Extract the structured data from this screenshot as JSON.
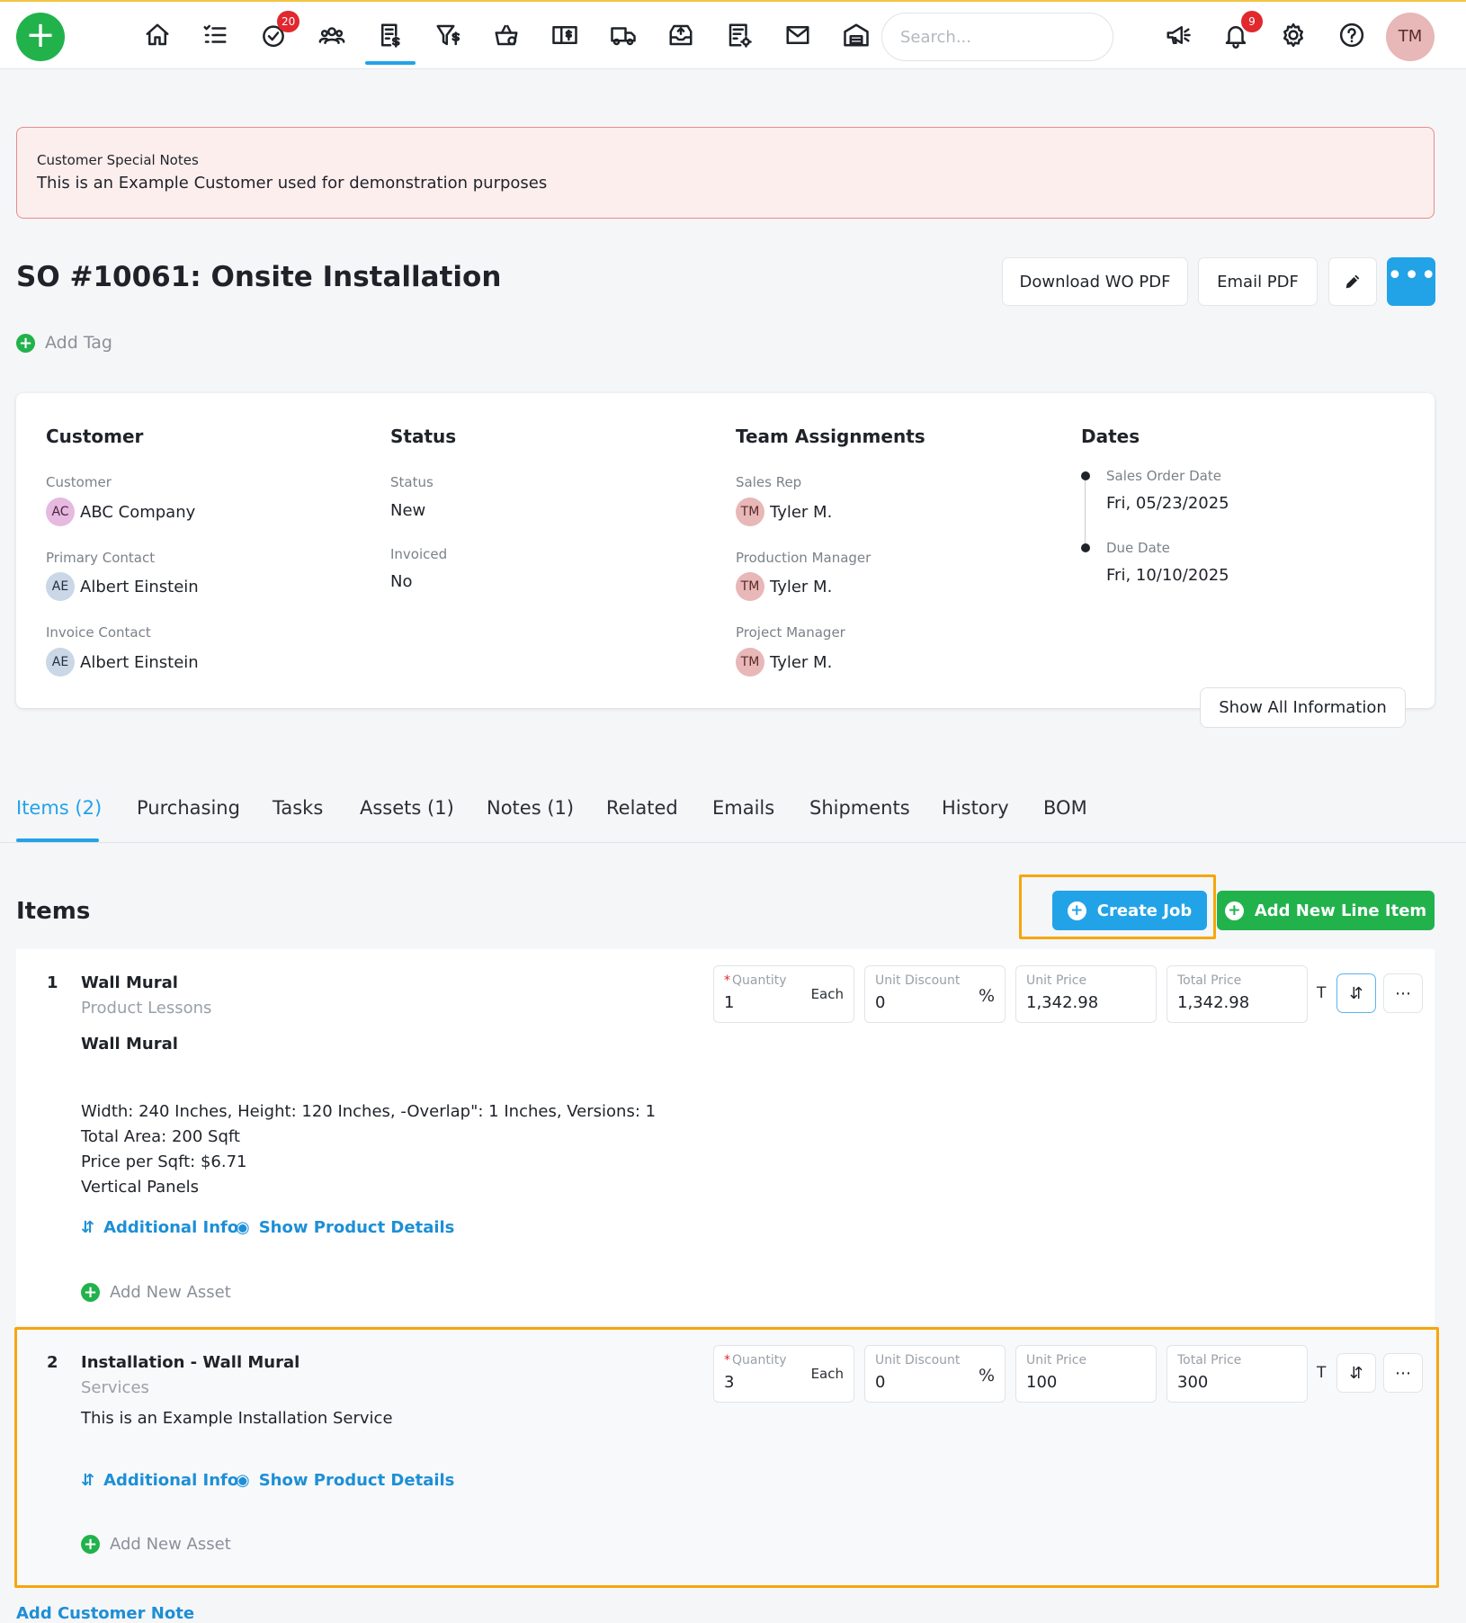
{
  "nav": {
    "add_icon": "plus-icon",
    "icons": [
      "home-icon",
      "list-icon",
      "check-circle-icon",
      "users-icon",
      "invoice-icon",
      "funnel-dollar-icon",
      "basket-icon",
      "catalog-icon",
      "truck-icon",
      "inbox-icon",
      "report-gear-icon",
      "mail-icon",
      "warehouse-icon"
    ],
    "tasks_badge": "20",
    "notifications_badge": "9",
    "search_placeholder": "Search...",
    "right_icons": [
      "megaphone-icon",
      "bell-icon",
      "gear-icon",
      "help-icon"
    ],
    "user_initials": "TM",
    "accent": "#22a3e8",
    "brand_green": "#22b24c"
  },
  "notes": {
    "title": "Customer Special Notes",
    "text": "This is an Example Customer used for demonstration purposes"
  },
  "header": {
    "title": "SO #10061: Onsite Installation",
    "download_btn": "Download WO PDF",
    "email_btn": "Email PDF",
    "edit_icon": "pencil-icon",
    "more_icon": "ellipsis-icon",
    "add_tag": "Add Tag"
  },
  "info": {
    "customer": {
      "heading": "Customer",
      "customer_label": "Customer",
      "customer_initials": "AC",
      "customer_name": "ABC Company",
      "primary_label": "Primary Contact",
      "primary_initials": "AE",
      "primary_name": "Albert Einstein",
      "invoice_label": "Invoice Contact",
      "invoice_initials": "AE",
      "invoice_name": "Albert Einstein"
    },
    "status": {
      "heading": "Status",
      "status_label": "Status",
      "status_value": "New",
      "invoiced_label": "Invoiced",
      "invoiced_value": "No"
    },
    "team": {
      "heading": "Team Assignments",
      "sales_label": "Sales Rep",
      "sales_initials": "TM",
      "sales_name": "Tyler M.",
      "prod_label": "Production Manager",
      "prod_initials": "TM",
      "prod_name": "Tyler M.",
      "proj_label": "Project Manager",
      "proj_initials": "TM",
      "proj_name": "Tyler M."
    },
    "dates": {
      "heading": "Dates",
      "so_label": "Sales Order Date",
      "so_value": "Fri, 05/23/2025",
      "due_label": "Due Date",
      "due_value": "Fri, 10/10/2025"
    },
    "show_all": "Show All Information"
  },
  "tabs": [
    "Items (2)",
    "Purchasing",
    "Tasks",
    "Assets (1)",
    "Notes (1)",
    "Related",
    "Emails",
    "Shipments",
    "History",
    "BOM"
  ],
  "items_section": {
    "heading": "Items",
    "create_job": "Create Job",
    "add_line": "Add New Line Item",
    "highlight_color": "#f5a60d"
  },
  "line_labels": {
    "quantity": "Quantity",
    "unit_discount": "Unit Discount",
    "unit_price": "Unit Price",
    "total_price": "Total Price",
    "tax_flag": "T",
    "additional_info": "Additional Info",
    "show_details": "Show Product Details",
    "add_asset": "Add New Asset"
  },
  "items": [
    {
      "num": "1",
      "name": "Wall Mural",
      "category": "Product Lessons",
      "subtitle": "Wall Mural",
      "details": [
        "Width: 240 Inches, Height: 120 Inches, -Overlap\": 1 Inches, Versions: 1",
        "Total Area: 200 Sqft",
        "Price per Sqft: $6.71",
        "Vertical Panels"
      ],
      "quantity": "1",
      "unit": "Each",
      "discount": "0",
      "discount_unit": "%",
      "unit_price": "1,342.98",
      "total_price": "1,342.98"
    },
    {
      "num": "2",
      "name": "Installation - Wall Mural",
      "category": "Services",
      "description": "This is an Example Installation Service",
      "quantity": "3",
      "unit": "Each",
      "discount": "0",
      "discount_unit": "%",
      "unit_price": "100",
      "total_price": "300"
    }
  ],
  "add_customer_note": "Add Customer Note"
}
